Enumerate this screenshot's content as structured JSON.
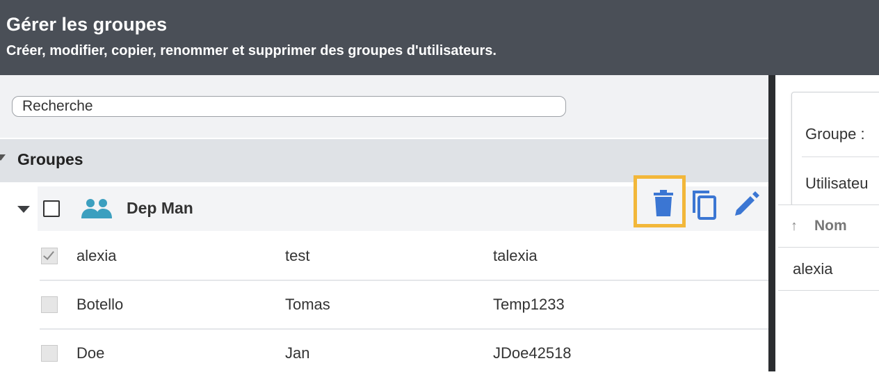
{
  "header": {
    "title": "Gérer les groupes",
    "subtitle": "Créer, modifier, copier, renommer et supprimer des groupes d'utilisateurs."
  },
  "search": {
    "placeholder": "Recherche"
  },
  "groups": {
    "label": "Groupes",
    "group": {
      "name": "Dep Man",
      "icons": [
        "people-icon",
        "trash-icon",
        "copy-icon",
        "edit-icon"
      ],
      "members": [
        {
          "last": "alexia",
          "first": "test",
          "login": "talexia",
          "checked": true
        },
        {
          "last": "Botello",
          "first": "Tomas",
          "login": "Temp1233",
          "checked": false
        },
        {
          "last": "Doe",
          "first": "Jan",
          "login": "JDoe42518",
          "checked": false
        }
      ]
    }
  },
  "details": {
    "group_label": "Groupe :",
    "users_label": "Utilisateu",
    "column": {
      "sort_icon": "↑",
      "name_label": "Nom"
    },
    "rows": [
      "alexia"
    ]
  },
  "colors": {
    "accent": "#3b76d3",
    "highlight": "#f2b73a",
    "header_bg": "#4a4f57",
    "people_icon": "#3c9fbf"
  }
}
